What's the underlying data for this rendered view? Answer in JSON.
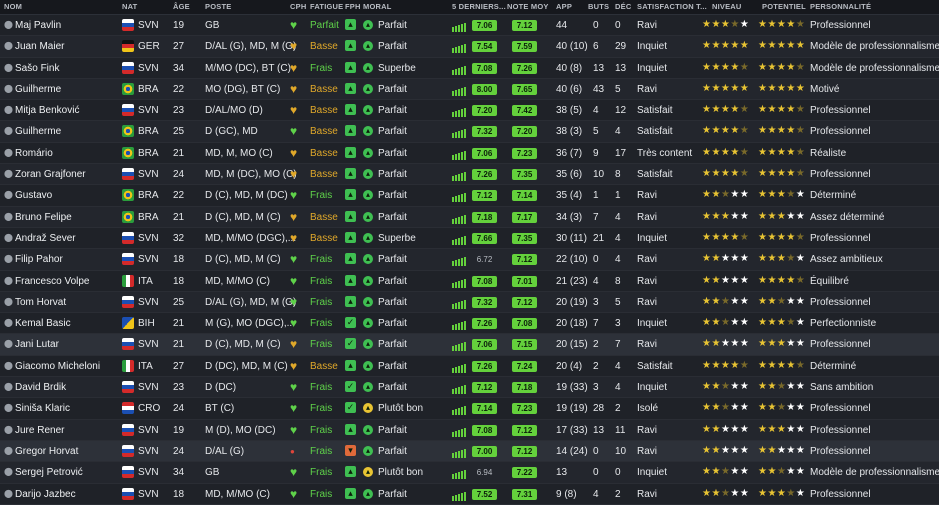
{
  "headers": {
    "nom": "NOM",
    "nat": "NAT",
    "age": "ÂGE",
    "poste": "POSTE",
    "cph": "CPH",
    "fatigue": "FATIGUE",
    "fph": "FPH",
    "moral": "MORAL",
    "derniers": "5 DERNIERS...",
    "note_moy": "NOTE MOY",
    "app": "APP",
    "buts": "BUTS",
    "dec": "DÉC",
    "satisfaction": "SATISFACTION T...",
    "niveau": "NIVEAU",
    "potentiel": "POTENTIEL",
    "personnalite": "PERSONNALITÉ"
  },
  "colors": {
    "good": "#64d13c",
    "amber": "#e0a82a",
    "star": "#e8c433"
  },
  "players": [
    {
      "name": "Maj Pavlin",
      "nat": "SVN",
      "age": "19",
      "pos": "GB",
      "cph": "heart-green",
      "fatigue": "Parfait",
      "fph": "up",
      "moral_icon": "green",
      "moral": "Parfait",
      "r5": "7.06",
      "rm": "7.12",
      "app": "44",
      "buts": "0",
      "dec": "0",
      "sat": "Ravi",
      "niv": 3.5,
      "pot": 4.5,
      "pers": "Professionnel"
    },
    {
      "name": "Juan Maier",
      "nat": "GER",
      "age": "27",
      "pos": "D/AL (G), MD, M (G)",
      "cph": "heart-amber",
      "fatigue": "Basse",
      "fph": "up",
      "moral_icon": "green",
      "moral": "Parfait",
      "r5": "7.54",
      "rm": "7.59",
      "app": "40 (10)",
      "buts": "6",
      "dec": "29",
      "sat": "Inquiet",
      "niv": 5,
      "pot": 5,
      "pers": "Modèle de professionnalisme"
    },
    {
      "name": "Sašo Fink",
      "nat": "SVN",
      "age": "34",
      "pos": "M/MO (DC), BT (C)",
      "cph": "heart-amber",
      "fatigue": "Frais",
      "fph": "up",
      "moral_icon": "green",
      "moral": "Superbe",
      "r5": "7.08",
      "rm": "7.26",
      "app": "40 (8)",
      "buts": "13",
      "dec": "13",
      "sat": "Inquiet",
      "niv": 4.5,
      "pot": 4.5,
      "pers": "Modèle de professionnalisme"
    },
    {
      "name": "Guilherme",
      "nat": "BRA",
      "age": "22",
      "pos": "MO (DG), BT (C)",
      "cph": "heart-amber",
      "fatigue": "Basse",
      "fph": "up",
      "moral_icon": "green",
      "moral": "Parfait",
      "r5": "8.00",
      "rm": "7.65",
      "app": "40 (6)",
      "buts": "43",
      "dec": "5",
      "sat": "Ravi",
      "niv": 5,
      "pot": 5,
      "pers": "Motivé"
    },
    {
      "name": "Mitja Benković",
      "nat": "SVN",
      "age": "23",
      "pos": "D/AL/MO (D)",
      "cph": "heart-amber",
      "fatigue": "Basse",
      "fph": "up",
      "moral_icon": "green",
      "moral": "Parfait",
      "r5": "7.20",
      "rm": "7.42",
      "app": "38 (5)",
      "buts": "4",
      "dec": "12",
      "sat": "Satisfait",
      "niv": 4.5,
      "pot": 4.5,
      "pers": "Professionnel"
    },
    {
      "name": "Guilherme",
      "nat": "BRA",
      "age": "25",
      "pos": "D (GC), MD",
      "cph": "heart-green",
      "fatigue": "Basse",
      "fph": "up",
      "moral_icon": "green",
      "moral": "Parfait",
      "r5": "7.32",
      "rm": "7.20",
      "app": "38 (3)",
      "buts": "5",
      "dec": "4",
      "sat": "Satisfait",
      "niv": 4.5,
      "pot": 4.5,
      "pers": "Professionnel"
    },
    {
      "name": "Romário",
      "nat": "BRA",
      "age": "21",
      "pos": "MD, M, MO (C)",
      "cph": "heart-amber",
      "fatigue": "Basse",
      "fph": "up",
      "moral_icon": "green",
      "moral": "Parfait",
      "r5": "7.06",
      "rm": "7.23",
      "app": "36 (7)",
      "buts": "9",
      "dec": "17",
      "sat": "Très content",
      "niv": 4.5,
      "pot": 4.5,
      "pers": "Réaliste"
    },
    {
      "name": "Zoran Grajfoner",
      "nat": "SVN",
      "age": "24",
      "pos": "MD, M (DC), MO (C)",
      "cph": "heart-amber",
      "fatigue": "Basse",
      "fph": "up",
      "moral_icon": "green",
      "moral": "Parfait",
      "r5": "7.26",
      "rm": "7.35",
      "app": "35 (6)",
      "buts": "10",
      "dec": "8",
      "sat": "Satisfait",
      "niv": 4.5,
      "pot": 4.5,
      "pers": "Professionnel"
    },
    {
      "name": "Gustavo",
      "nat": "BRA",
      "age": "22",
      "pos": "D (C), MD, M (DC)",
      "cph": "heart-green",
      "fatigue": "Frais",
      "fph": "up",
      "moral_icon": "green",
      "moral": "Parfait",
      "r5": "7.12",
      "rm": "7.14",
      "app": "35 (4)",
      "buts": "1",
      "dec": "1",
      "sat": "Ravi",
      "niv": 2.5,
      "pot": 3.5,
      "pers": "Déterminé"
    },
    {
      "name": "Bruno Felipe",
      "nat": "BRA",
      "age": "21",
      "pos": "D (C), MD, M (C)",
      "cph": "heart-amber",
      "fatigue": "Basse",
      "fph": "up",
      "moral_icon": "green",
      "moral": "Parfait",
      "r5": "7.18",
      "rm": "7.17",
      "app": "34 (3)",
      "buts": "7",
      "dec": "4",
      "sat": "Ravi",
      "niv": 3,
      "pot": 3,
      "pers": "Assez déterminé"
    },
    {
      "name": "Andraž Sever",
      "nat": "SVN",
      "age": "32",
      "pos": "MD, M/MO (DGC),...",
      "cph": "heart-amber",
      "fatigue": "Basse",
      "fph": "up",
      "moral_icon": "green",
      "moral": "Superbe",
      "r5": "7.66",
      "rm": "7.35",
      "app": "30 (11)",
      "buts": "21",
      "dec": "4",
      "sat": "Inquiet",
      "niv": 4.5,
      "pot": 4.5,
      "pers": "Professionnel"
    },
    {
      "name": "Filip Pahor",
      "nat": "SVN",
      "age": "18",
      "pos": "D (C), MD, M (C)",
      "cph": "heart-green",
      "fatigue": "Frais",
      "fph": "up",
      "moral_icon": "green",
      "moral": "Parfait",
      "r5": "6.72",
      "rm": "7.12",
      "app": "22 (10)",
      "buts": "0",
      "dec": "4",
      "sat": "Ravi",
      "niv": 2,
      "pot": 3.5,
      "pers": "Assez ambitieux"
    },
    {
      "name": "Francesco Volpe",
      "nat": "ITA",
      "age": "18",
      "pos": "MD, M/MO (C)",
      "cph": "heart-green",
      "fatigue": "Frais",
      "fph": "up",
      "moral_icon": "green",
      "moral": "Parfait",
      "r5": "7.08",
      "rm": "7.01",
      "app": "21 (23)",
      "buts": "4",
      "dec": "8",
      "sat": "Ravi",
      "niv": 2,
      "pot": 4.5,
      "pers": "Équilibré"
    },
    {
      "name": "Tom Horvat",
      "nat": "SVN",
      "age": "25",
      "pos": "D/AL (G), MD, M (G)",
      "cph": "heart-green",
      "fatigue": "Frais",
      "fph": "up",
      "moral_icon": "green",
      "moral": "Parfait",
      "r5": "7.32",
      "rm": "7.12",
      "app": "20 (19)",
      "buts": "3",
      "dec": "5",
      "sat": "Ravi",
      "niv": 2.5,
      "pot": 2.5,
      "pers": "Professionnel"
    },
    {
      "name": "Kemal Basic",
      "nat": "BIH",
      "age": "21",
      "pos": "M (G), MO (DGC),...",
      "cph": "heart-green",
      "fatigue": "Frais",
      "fph": "check",
      "moral_icon": "green",
      "moral": "Parfait",
      "r5": "7.26",
      "rm": "7.08",
      "app": "20 (18)",
      "buts": "7",
      "dec": "3",
      "sat": "Inquiet",
      "niv": 2.5,
      "pot": 3.5,
      "pers": "Perfectionniste"
    },
    {
      "name": "Jani Lutar",
      "nat": "SVN",
      "age": "21",
      "pos": "D (C), MD, M (C)",
      "cph": "heart-amber",
      "fatigue": "Frais",
      "fph": "check",
      "moral_icon": "green",
      "moral": "Parfait",
      "r5": "7.06",
      "rm": "7.15",
      "app": "20 (15)",
      "buts": "2",
      "dec": "7",
      "sat": "Ravi",
      "niv": 2,
      "pot": 3,
      "pers": "Professionnel"
    },
    {
      "name": "Giacomo Micheloni",
      "nat": "ITA",
      "age": "27",
      "pos": "D (DC), MD, M (C)",
      "cph": "heart-amber",
      "fatigue": "Basse",
      "fph": "up",
      "moral_icon": "green",
      "moral": "Parfait",
      "r5": "7.26",
      "rm": "7.24",
      "app": "20 (4)",
      "buts": "2",
      "dec": "4",
      "sat": "Satisfait",
      "niv": 4.5,
      "pot": 4.5,
      "pers": "Déterminé"
    },
    {
      "name": "David Brdik",
      "nat": "SVN",
      "age": "23",
      "pos": "D (DC)",
      "cph": "heart-green",
      "fatigue": "Frais",
      "fph": "check",
      "moral_icon": "green",
      "moral": "Parfait",
      "r5": "7.12",
      "rm": "7.18",
      "app": "19 (33)",
      "buts": "3",
      "dec": "4",
      "sat": "Inquiet",
      "niv": 2.5,
      "pot": 2.5,
      "pers": "Sans ambition"
    },
    {
      "name": "Siniša Klaric",
      "nat": "CRO",
      "age": "24",
      "pos": "BT (C)",
      "cph": "heart-green",
      "fatigue": "Frais",
      "fph": "check",
      "moral_icon": "yellow",
      "moral": "Plutôt bon",
      "r5": "7.14",
      "rm": "7.23",
      "app": "19 (19)",
      "buts": "28",
      "dec": "2",
      "sat": "Isolé",
      "niv": 2.5,
      "pot": 2.5,
      "pers": "Professionnel"
    },
    {
      "name": "Jure Rener",
      "nat": "SVN",
      "age": "19",
      "pos": "M (D), MO (DC)",
      "cph": "heart-green",
      "fatigue": "Frais",
      "fph": "up",
      "moral_icon": "green",
      "moral": "Parfait",
      "r5": "7.08",
      "rm": "7.12",
      "app": "17 (33)",
      "buts": "13",
      "dec": "11",
      "sat": "Ravi",
      "niv": 2,
      "pot": 3,
      "pers": "Professionnel"
    },
    {
      "name": "Gregor Horvat",
      "nat": "SVN",
      "age": "24",
      "pos": "D/AL (G)",
      "cph": "dot-red",
      "fatigue": "Frais",
      "fph": "down",
      "moral_icon": "green",
      "moral": "Parfait",
      "r5": "7.00",
      "rm": "7.12",
      "app": "14 (24)",
      "buts": "0",
      "dec": "10",
      "sat": "Ravi",
      "niv": 2,
      "pot": 2,
      "pers": "Professionnel"
    },
    {
      "name": "Sergej Petrović",
      "nat": "SVN",
      "age": "34",
      "pos": "GB",
      "cph": "heart-green",
      "fatigue": "Frais",
      "fph": "up",
      "moral_icon": "yellow",
      "moral": "Plutôt bon",
      "r5": "6.94",
      "rm": "7.22",
      "app": "13",
      "buts": "0",
      "dec": "0",
      "sat": "Inquiet",
      "niv": 2.5,
      "pot": 2.5,
      "pers": "Modèle de professionnalisme"
    },
    {
      "name": "Darijo Jazbec",
      "nat": "SVN",
      "age": "18",
      "pos": "MD, M/MO (C)",
      "cph": "heart-green",
      "fatigue": "Frais",
      "fph": "up",
      "moral_icon": "green",
      "moral": "Parfait",
      "r5": "7.52",
      "rm": "7.31",
      "app": "9 (8)",
      "buts": "4",
      "dec": "2",
      "sat": "Ravi",
      "niv": 2.5,
      "pot": 3.5,
      "pers": "Professionnel"
    }
  ]
}
